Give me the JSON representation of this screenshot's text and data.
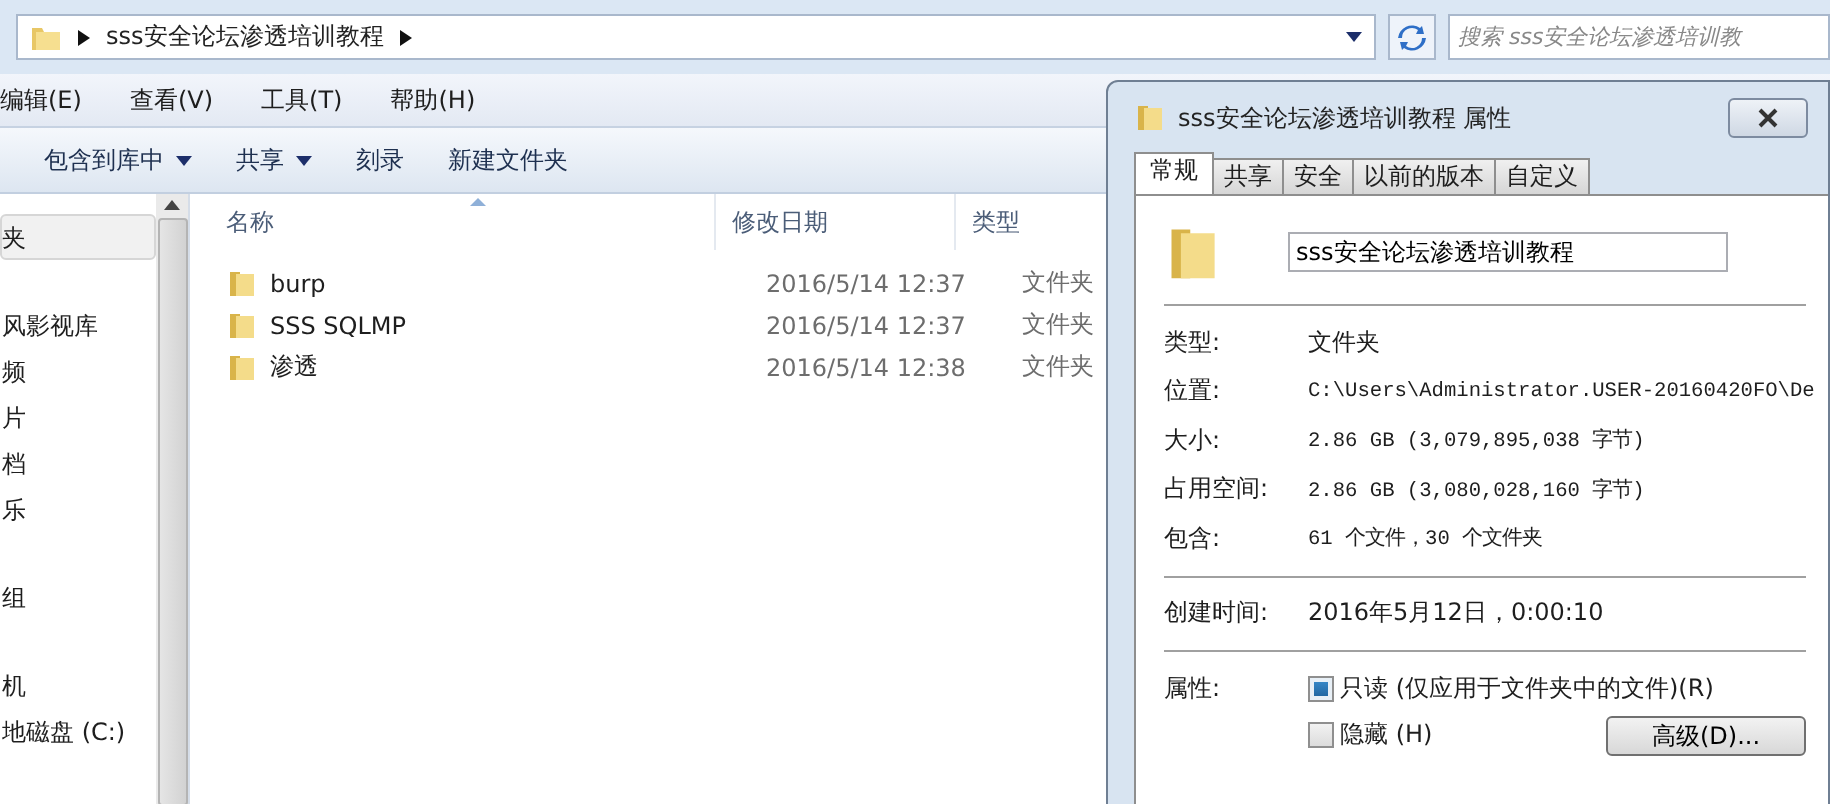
{
  "explorer": {
    "breadcrumb": [
      "sss安全论坛渗透培训教程"
    ],
    "search": {
      "placeholder": "搜索 sss安全论坛渗透培训教"
    },
    "menu": [
      "编辑(E)",
      "查看(V)",
      "工具(T)",
      "帮助(H)"
    ],
    "toolbar": [
      {
        "label": "包含到库中",
        "dropdown": true
      },
      {
        "label": "共享",
        "dropdown": true
      },
      {
        "label": "刻录",
        "dropdown": false
      },
      {
        "label": "新建文件夹",
        "dropdown": false
      }
    ],
    "nav_groups": [
      [
        {
          "label": "夹",
          "selected": true
        }
      ],
      [
        {
          "label": "风影视库",
          "selected": false
        },
        {
          "label": "频",
          "selected": false
        },
        {
          "label": "片",
          "selected": false
        },
        {
          "label": "档",
          "selected": false
        },
        {
          "label": "乐",
          "selected": false
        }
      ],
      [
        {
          "label": "组",
          "selected": false
        }
      ],
      [
        {
          "label": "机",
          "selected": false
        },
        {
          "label": "地磁盘 (C:)",
          "selected": false
        }
      ]
    ],
    "columns": [
      "名称",
      "修改日期",
      "类型"
    ],
    "files": [
      {
        "name": "burp",
        "modified": "2016/5/14 12:37",
        "type": "文件夹"
      },
      {
        "name": "SSS SQLMP",
        "modified": "2016/5/14 12:37",
        "type": "文件夹"
      },
      {
        "name": "渗透",
        "modified": "2016/5/14 12:38",
        "type": "文件夹"
      }
    ]
  },
  "dialog": {
    "title": "sss安全论坛渗透培训教程 属性",
    "tabs": [
      {
        "label": "常规",
        "selected": true
      },
      {
        "label": "共享",
        "selected": false
      },
      {
        "label": "安全",
        "selected": false
      },
      {
        "label": "以前的版本",
        "selected": false
      },
      {
        "label": "自定义",
        "selected": false
      }
    ],
    "name_value": "sss安全论坛渗透培训教程",
    "sections": [
      [
        {
          "label": "类型:",
          "value": "文件夹",
          "kind": "text"
        },
        {
          "label": "位置:",
          "value": "C:\\Users\\Administrator.USER-20160420FO\\De",
          "kind": "mono"
        },
        {
          "label": "大小:",
          "value": "2.86 GB (3,079,895,038 字节)",
          "kind": "mono"
        },
        {
          "label": "占用空间:",
          "value": "2.86 GB (3,080,028,160 字节)",
          "kind": "mono"
        },
        {
          "label": "包含:",
          "value": "61 个文件，30 个文件夹",
          "kind": "mono"
        }
      ],
      [
        {
          "label": "创建时间:",
          "value": "2016年5月12日，0:00:10",
          "kind": "text"
        }
      ]
    ],
    "attributes_label": "属性:",
    "attributes": [
      {
        "label": "只读 (仅应用于文件夹中的文件)(R)",
        "checked": true
      },
      {
        "label": "隐藏 (H)",
        "checked": false
      }
    ],
    "advanced_button": "高级(D)..."
  }
}
